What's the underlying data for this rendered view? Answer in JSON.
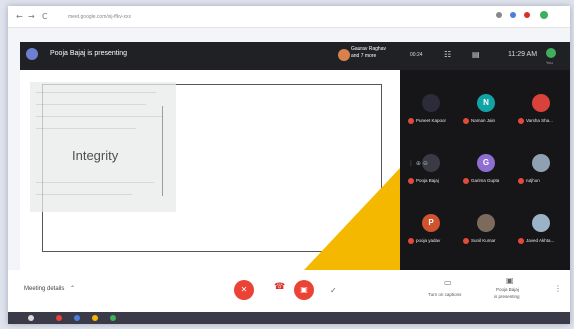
{
  "browser": {
    "url": "meet.google.com/xij-ffkv-xxx",
    "nav_back": "←",
    "nav_forward": "→",
    "nav_reload": "C"
  },
  "presenter": {
    "banner_text": "Pooja Bajaj is presenting",
    "others_name": "Gaurav Raghav",
    "others_count": "and 7 more"
  },
  "slide": {
    "title": "Integrity",
    "accent_color": "#f5b800"
  },
  "side_panel": {
    "elapsed": "00:24",
    "clock": "11:29 AM",
    "you_label": "You",
    "participants": [
      {
        "name": "Puneet Kapoor",
        "initial": "",
        "color": "#2b2b3a"
      },
      {
        "name": "Naman Jain",
        "initial": "N",
        "color": "#12a4a4"
      },
      {
        "name": "Varsha Sha...",
        "initial": "",
        "color": "#d9423a"
      },
      {
        "name": "Pooja Bajaj",
        "initial": "",
        "color": "#3a3a44"
      },
      {
        "name": "Garima Gupta",
        "initial": "G",
        "color": "#8e6fd1"
      },
      {
        "name": "rutjhun",
        "initial": "",
        "color": "#8fa0b2"
      },
      {
        "name": "pooja yadav",
        "initial": "P",
        "color": "#d0522e"
      },
      {
        "name": "Sunil Kumar",
        "initial": "",
        "color": "#7c6a5d"
      },
      {
        "name": "Javed Akhta...",
        "initial": "",
        "color": "#9bb3c7"
      }
    ]
  },
  "bottom": {
    "meeting_details": "Meeting details",
    "captions_label": "Turn on captions",
    "presenting_name": "Pooja Bajaj",
    "presenting_label": "is presenting"
  }
}
